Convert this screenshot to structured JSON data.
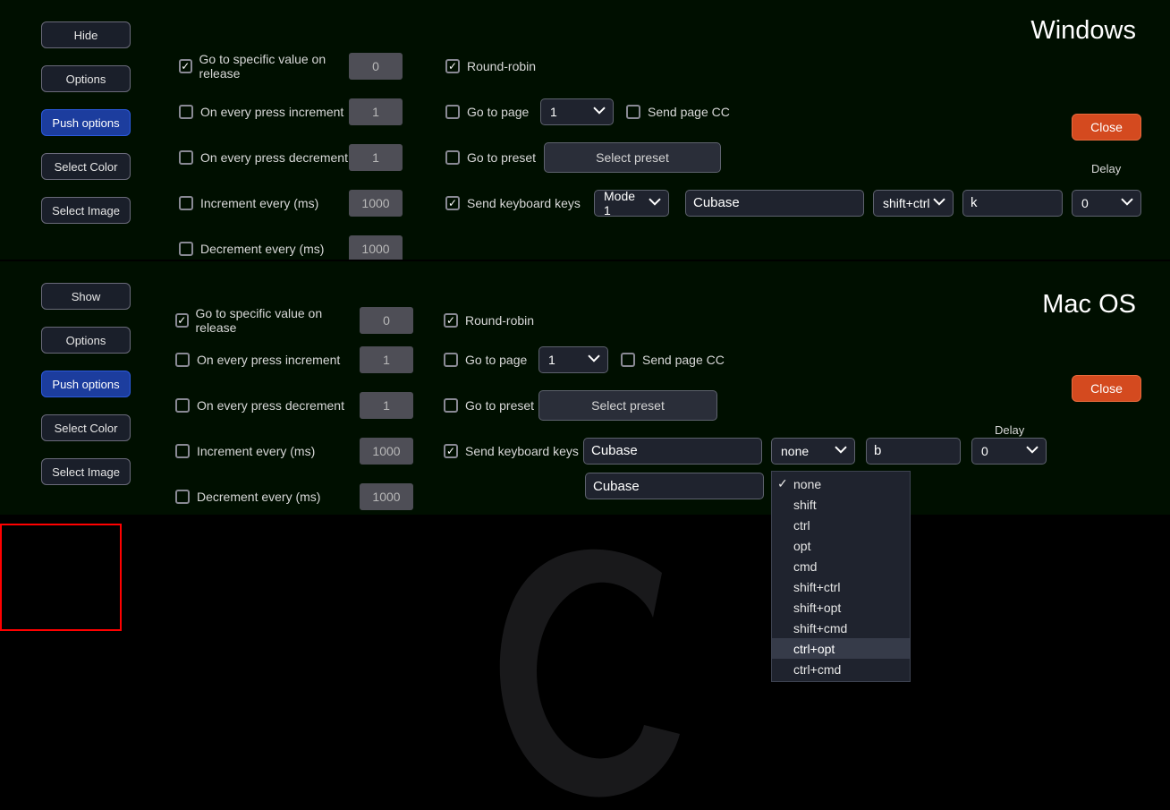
{
  "os_labels": {
    "win": "Windows",
    "mac": "Mac OS"
  },
  "close_label": "Close",
  "side_buttons": {
    "win": [
      "Hide",
      "Options",
      "Push options",
      "Select Color",
      "Select Image"
    ],
    "mac": [
      "Show",
      "Options",
      "Push options",
      "Select Color",
      "Select Image"
    ]
  },
  "opts": {
    "goto_release": "Go to specific value on release",
    "inc_press": "On every press increment",
    "dec_press": "On every press decrement",
    "inc_every": "Increment every (ms)",
    "dec_every": "Decrement every (ms)",
    "val_release": "0",
    "val_inc": "1",
    "val_dec": "1",
    "val_incms": "1000",
    "val_decms": "1000"
  },
  "col2": {
    "round_robin": "Round-robin",
    "goto_page": "Go to page",
    "page_val": "1",
    "send_page_cc": "Send page CC",
    "goto_preset": "Go to preset",
    "select_preset": "Select preset",
    "send_kbd": "Send keyboard keys",
    "mode_val": "Mode 1",
    "cubase": "Cubase",
    "modifier_win": "shift+ctrl",
    "key_win": "k",
    "modifier_mac_sel": "none",
    "key_mac": "b",
    "delay_label": "Delay",
    "delay_val": "0"
  },
  "modifier_menu": {
    "items": [
      "none",
      "shift",
      "ctrl",
      "opt",
      "cmd",
      "shift+ctrl",
      "shift+opt",
      "shift+cmd",
      "ctrl+opt",
      "ctrl+cmd"
    ],
    "checked": "none",
    "highlighted": "ctrl+opt"
  }
}
